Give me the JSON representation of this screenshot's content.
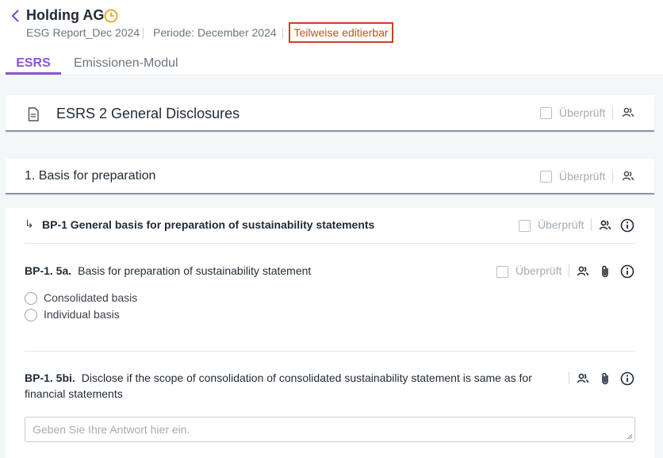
{
  "header": {
    "title": "Holding AG",
    "report": "ESG Report_Dec 2024",
    "period": "Periode: December 2024",
    "status_badge": "Teilweise editierbar"
  },
  "tabs": [
    {
      "label": "ESRS",
      "active": true
    },
    {
      "label": "Emissionen-Modul",
      "active": false
    }
  ],
  "reviewed_label": "Überprüft",
  "sections": {
    "esrs2": {
      "title": "ESRS 2 General Disclosures"
    },
    "basis": {
      "title": "1. Basis for preparation"
    }
  },
  "bp1": {
    "arrow": "↳",
    "title": "BP-1  General basis for preparation of sustainability statements"
  },
  "q5a": {
    "code": "BP-1. 5a.",
    "text": "Basis for preparation of sustainability statement",
    "options": [
      "Consolidated basis",
      "Individual basis"
    ]
  },
  "q5bi": {
    "code": "BP-1. 5bi.",
    "text": "Disclose if the scope of consolidation of consolidated sustainability statement is same as for financial statements",
    "placeholder": "Geben Sie Ihre Antwort hier ein."
  },
  "colors": {
    "accent": "#8b55d1",
    "badge_border": "#c8441d",
    "clock": "#f0a019",
    "background": "#f2f7f7"
  },
  "icons": [
    "chevron-left-icon",
    "clock-icon",
    "document-icon",
    "users-icon",
    "info-icon",
    "paperclip-icon"
  ]
}
